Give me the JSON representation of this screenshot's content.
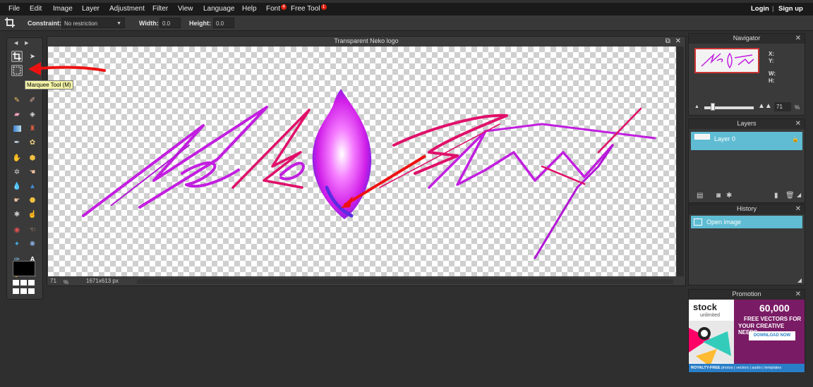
{
  "menu": {
    "items": [
      "File",
      "Edit",
      "Image",
      "Layer",
      "Adjustment",
      "Filter",
      "View",
      "Language",
      "Help"
    ],
    "font": {
      "label": "Font",
      "badge": "4"
    },
    "free_tool": {
      "label": "Free Tool",
      "badge": "1"
    },
    "login": "Login",
    "separator": "|",
    "signup": "Sign up"
  },
  "options": {
    "constraint_label": "Constraint:",
    "constraint_value": "No restriction",
    "width_label": "Width:",
    "width_value": "0.0",
    "height_label": "Height:",
    "height_value": "0.0"
  },
  "tooltip": "Marquee Tool (M)",
  "canvas": {
    "title": "Transparent Neko logo",
    "zoom": "71",
    "zoom_unit": "%",
    "dimensions": "1671x613 px"
  },
  "navigator": {
    "title": "Navigator",
    "x_label": "X:",
    "y_label": "Y:",
    "w_label": "W:",
    "h_label": "H:",
    "zoom_value": "71",
    "zoom_unit": "%"
  },
  "layers": {
    "title": "Layers",
    "items": [
      {
        "name": "Layer 0"
      }
    ]
  },
  "history": {
    "title": "History",
    "items": [
      {
        "name": "Open image"
      }
    ]
  },
  "promotion": {
    "title": "Promotion",
    "brand": "stock",
    "brand_sub": "unlimited",
    "headline": "60,000",
    "line1": "FREE VECTORS FOR",
    "line2": "YOUR CREATIVE NEEDS",
    "cta": "DOWNLOAD NOW",
    "footer_bold": "ROYALTY-FREE",
    "footer_rest": "photos | vectors | audio | templates"
  },
  "colors": {
    "accent": "#5fbcd3",
    "menubar": "#1a1a1a",
    "panel": "#3a3a3a",
    "annotation_arrow": "#ee1111",
    "logo_primary": "#c21ee0",
    "logo_secondary": "#e0106a"
  }
}
